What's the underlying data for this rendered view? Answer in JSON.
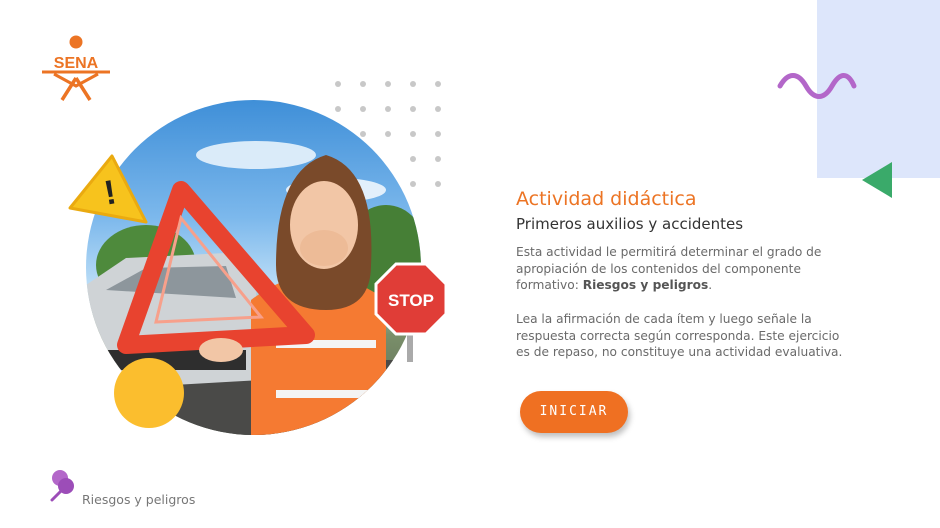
{
  "brand": {
    "logo_text": "SENA",
    "accent_color": "#ec7424"
  },
  "hero": {
    "stop_sign_text": "STOP",
    "icons": [
      "warning-icon",
      "stop-sign-icon",
      "warning-triangle-icon"
    ]
  },
  "content": {
    "title": "Actividad didáctica",
    "subtitle": "Primeros auxilios y accidentes",
    "paragraph1_text": "Esta actividad le permitirá determinar el grado de apropiación de los contenidos del componente formativo: ",
    "paragraph1_bold": "Riesgos y peligros",
    "paragraph1_end": ".",
    "paragraph2": "Lea la afirmación de cada ítem y luego señale la respuesta correcta según corresponda.  Este ejercicio es de repaso, no constituye una actividad evaluativa."
  },
  "start_button": {
    "label": "INICIAR",
    "color": "#ef7022"
  },
  "footer": {
    "label": "Riesgos y peligros"
  },
  "colors": {
    "panel": "#dde6fb",
    "wave": "#b367c9",
    "triangle": "#3aaa6a",
    "yellow": "#fbbe2e"
  }
}
